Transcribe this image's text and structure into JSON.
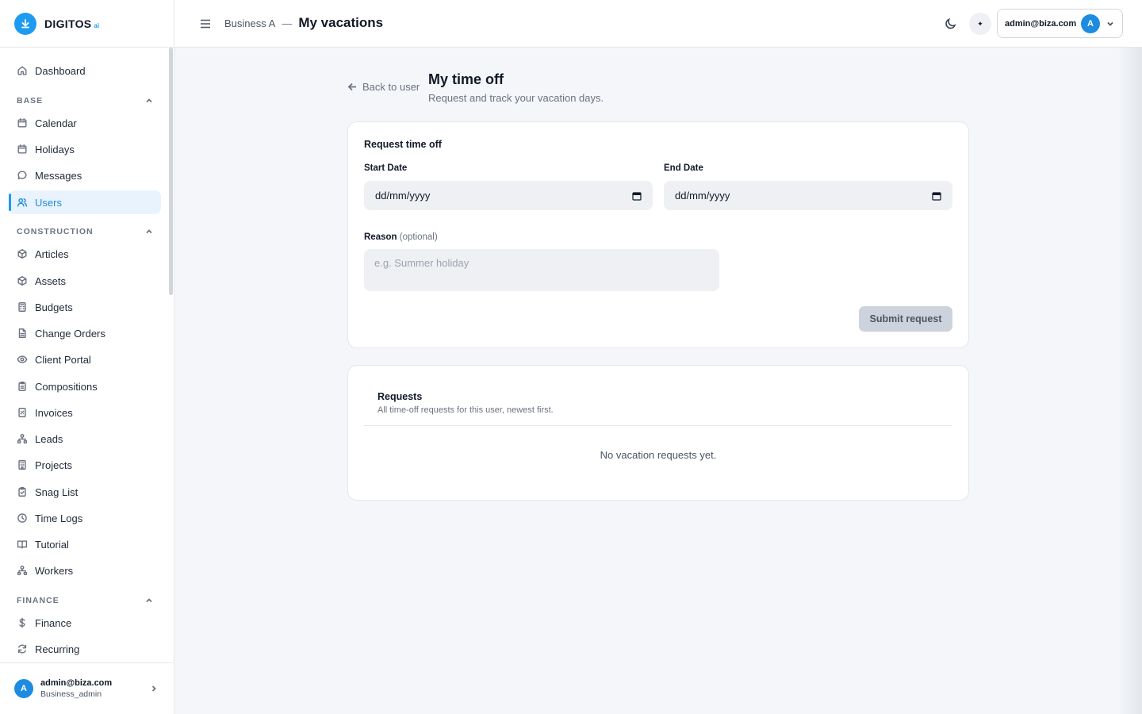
{
  "brand": {
    "name": "DIGITOS",
    "suffix": "ai"
  },
  "sidebar": {
    "dashboard": "Dashboard",
    "sections": {
      "base": "BASE",
      "construction": "CONSTRUCTION",
      "finance": "FINANCE"
    },
    "base_items": [
      "Calendar",
      "Holidays",
      "Messages",
      "Users"
    ],
    "construction_items": [
      "Articles",
      "Assets",
      "Budgets",
      "Change Orders",
      "Client Portal",
      "Compositions",
      "Invoices",
      "Leads",
      "Projects",
      "Snag List",
      "Time Logs",
      "Tutorial",
      "Workers"
    ],
    "finance_items": [
      "Finance",
      "Recurring"
    ],
    "active_item": "Users",
    "user": {
      "initial": "A",
      "email": "admin@biza.com",
      "role": "Business_admin"
    }
  },
  "header": {
    "business": "Business A",
    "separator": "—",
    "title": "My vacations",
    "account_email": "admin@biza.com",
    "account_initial": "A",
    "spark": "✦"
  },
  "page": {
    "back_label": "Back to user",
    "title": "My time off",
    "subtitle": "Request and track your vacation days."
  },
  "request_form": {
    "title": "Request time off",
    "start_label": "Start Date",
    "start_value": "dd/mm/yyyy",
    "end_label": "End Date",
    "end_value": "dd/mm/yyyy",
    "reason_label": "Reason",
    "reason_optional": "(optional)",
    "reason_placeholder": "e.g. Summer holiday",
    "submit_label": "Submit request"
  },
  "requests": {
    "title": "Requests",
    "subtitle": "All time-off requests for this user, newest first.",
    "empty": "No vacation requests yet."
  },
  "colors": {
    "accent": "#1d9bf0",
    "active_bg": "#e8f3fd",
    "page_bg": "#f4f6f9"
  }
}
